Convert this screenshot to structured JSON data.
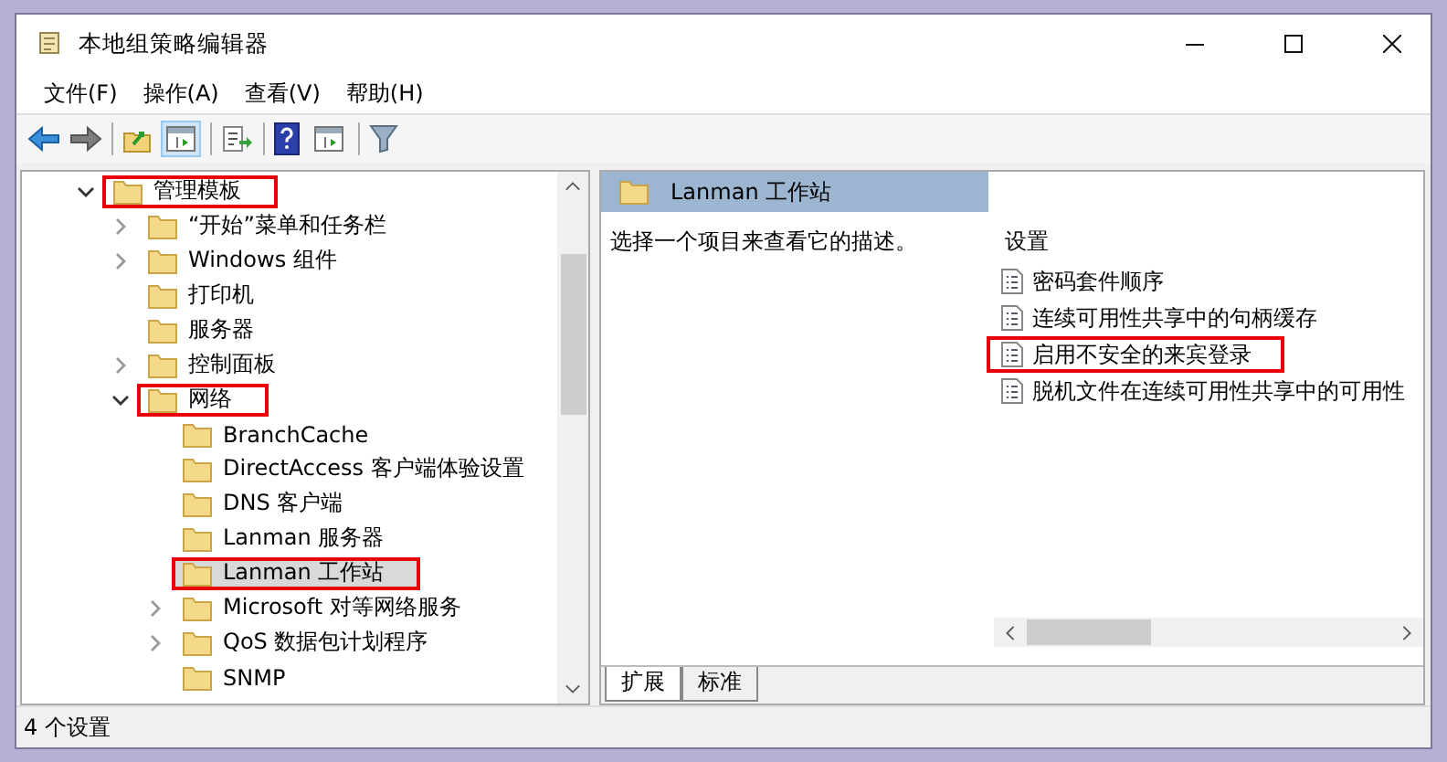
{
  "window": {
    "title": "本地组策略编辑器"
  },
  "menu": [
    "文件(F)",
    "操作(A)",
    "查看(V)",
    "帮助(H)"
  ],
  "toolbar": [
    {
      "kind": "back",
      "disabled": false
    },
    {
      "kind": "forward",
      "disabled": true
    },
    {
      "kind": "separator"
    },
    {
      "kind": "up",
      "disabled": false
    },
    {
      "kind": "panel",
      "pressed": true
    },
    {
      "kind": "separator"
    },
    {
      "kind": "export",
      "disabled": false
    },
    {
      "kind": "separator"
    },
    {
      "kind": "help",
      "disabled": false
    },
    {
      "kind": "panel",
      "pressed": false
    },
    {
      "kind": "separator"
    },
    {
      "kind": "filter",
      "disabled": false
    }
  ],
  "tree": [
    {
      "label": "管理模板",
      "expanded": true,
      "selected": false,
      "annotated": true,
      "children": [
        {
          "label": "“开始”菜单和任务栏",
          "expanded": false,
          "selected": false,
          "annotated": false
        },
        {
          "label": "Windows 组件",
          "expanded": false,
          "selected": false,
          "annotated": false
        },
        {
          "label": "打印机",
          "selected": false,
          "annotated": false
        },
        {
          "label": "服务器",
          "selected": false,
          "annotated": false
        },
        {
          "label": "控制面板",
          "expanded": false,
          "selected": false,
          "annotated": false
        },
        {
          "label": "网络",
          "expanded": true,
          "selected": false,
          "annotated": true,
          "children": [
            {
              "label": "BranchCache",
              "selected": false,
              "annotated": false
            },
            {
              "label": "DirectAccess 客户端体验设置",
              "selected": false,
              "annotated": false
            },
            {
              "label": "DNS 客户端",
              "selected": false,
              "annotated": false
            },
            {
              "label": "Lanman 服务器",
              "selected": false,
              "annotated": false
            },
            {
              "label": "Lanman 工作站",
              "selected": true,
              "annotated": true
            },
            {
              "label": "Microsoft 对等网络服务",
              "expanded": false,
              "selected": false,
              "annotated": false
            },
            {
              "label": "QoS 数据包计划程序",
              "expanded": false,
              "selected": false,
              "annotated": false
            },
            {
              "label": "SNMP",
              "selected": false,
              "annotated": false
            }
          ]
        }
      ]
    }
  ],
  "details": {
    "title": "Lanman 工作站",
    "description": "选择一个项目来查看它的描述。",
    "settings_heading": "设置",
    "settings": [
      {
        "label": "密码套件顺序",
        "annotated": false
      },
      {
        "label": "连续可用性共享中的句柄缓存",
        "annotated": false
      },
      {
        "label": "启用不安全的来宾登录",
        "annotated": true
      },
      {
        "label": "脱机文件在连续可用性共享中的可用性",
        "annotated": false
      }
    ]
  },
  "view_tabs": [
    {
      "label": "扩展",
      "selected": true
    },
    {
      "label": "标准",
      "selected": false
    }
  ],
  "status_bar": "4 个设置"
}
